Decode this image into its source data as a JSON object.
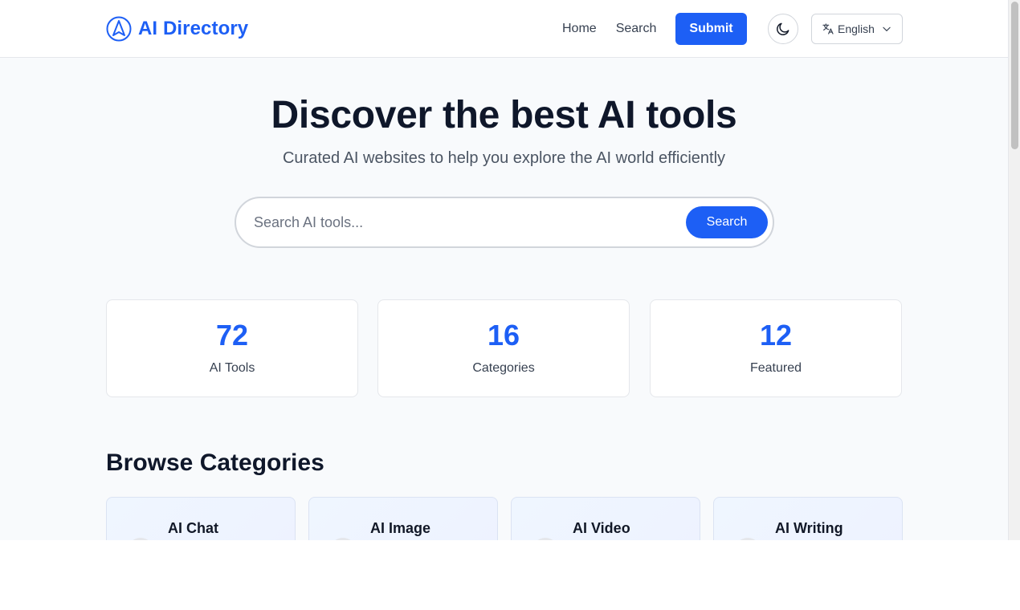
{
  "header": {
    "brand_name": "AI Directory",
    "nav": [
      "Home",
      "Search"
    ],
    "submit_label": "Submit",
    "language": "English"
  },
  "hero": {
    "title": "Discover the best AI tools",
    "subtitle": "Curated AI websites to help you explore the AI world efficiently",
    "search_placeholder": "Search AI tools...",
    "search_button": "Search"
  },
  "stats": [
    {
      "value": "72",
      "label": "AI Tools"
    },
    {
      "value": "16",
      "label": "Categories"
    },
    {
      "value": "12",
      "label": "Featured"
    }
  ],
  "categories": {
    "title": "Browse Categories",
    "items": [
      {
        "name": "AI Chat"
      },
      {
        "name": "AI Image"
      },
      {
        "name": "AI Video"
      },
      {
        "name": "AI Writing"
      }
    ]
  },
  "colors": {
    "accent": "#1d5ff5",
    "text": "#0f172a",
    "background": "#f8fafc"
  },
  "icons": {
    "logo": "navigation-arrow-icon",
    "theme": "moon-icon",
    "language": "translate-icon",
    "dropdown": "chevron-down-icon"
  }
}
